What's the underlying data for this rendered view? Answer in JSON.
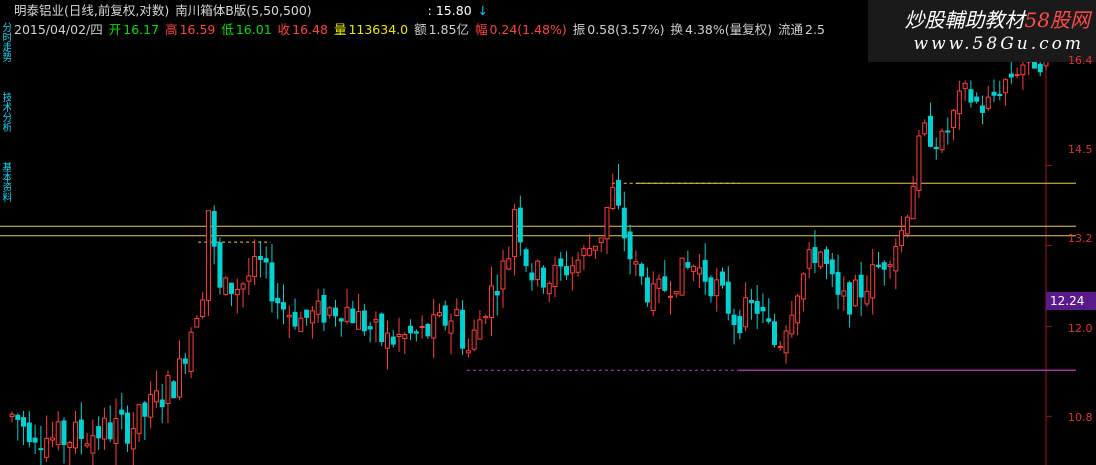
{
  "header": {
    "title": "明泰铝业(日线,前复权,对数)",
    "indicator": "南川箱体B版(5,50,500)",
    "level_value": ": 15.80",
    "date": "2015/04/02/四",
    "open_label": "开",
    "open": "16.17",
    "high_label": "高",
    "high": "16.59",
    "low_label": "低",
    "low": "16.01",
    "close_label": "收",
    "close": "16.48",
    "volume_label": "量",
    "volume": "113634.0",
    "amount_label": "额",
    "amount": "1.85亿",
    "change_label": "幅",
    "change": "0.24(1.48%)",
    "amplitude_label": "振",
    "amplitude": "0.58(3.57%)",
    "turnover_label": "换",
    "turnover": "4.38%(量复权)",
    "float_label": "流通",
    "float": "2.5"
  },
  "side_tabs": [
    "分时走势",
    "技术分析",
    "基本资料"
  ],
  "watermark": {
    "title_prefix": "炒股輔助教材",
    "title_suffix": "58股网",
    "url": "www.58Gu.com"
  },
  "price_box": "12.24",
  "y_ticks": [
    {
      "label": "16.4",
      "value": 16.4
    },
    {
      "label": "14.5",
      "value": 14.5
    },
    {
      "label": "13.2",
      "value": 13.2
    },
    {
      "label": "12.0",
      "value": 12.0
    },
    {
      "label": "10.8",
      "value": 10.8
    }
  ],
  "colors": {
    "up": "#ff3c3c",
    "down": "#00d2d2",
    "box_line": "#e6c84a",
    "support": "#c43cc4",
    "axis": "#a01818"
  },
  "chart_data": {
    "type": "candlestick",
    "levels": [
      {
        "value": 13.35,
        "style": "solid"
      },
      {
        "value": 13.5,
        "style": "solid"
      },
      {
        "value": 14.2,
        "style": "solid"
      },
      {
        "value": 11.4,
        "style": "solid"
      }
    ],
    "segments": [
      {
        "from": 0.18,
        "to": 0.25,
        "value": 13.25,
        "style": "dashed"
      },
      {
        "from": 0.58,
        "to": 0.99,
        "value": 14.2,
        "style": "dashed"
      },
      {
        "from": 0.44,
        "to": 0.99,
        "value": 11.4,
        "style": "dashed"
      }
    ],
    "candles_anchor": [
      [
        0.0,
        10.8
      ],
      [
        0.04,
        10.5
      ],
      [
        0.08,
        10.6
      ],
      [
        0.12,
        10.7
      ],
      [
        0.16,
        11.3
      ],
      [
        0.185,
        12.6
      ],
      [
        0.19,
        13.8
      ],
      [
        0.2,
        12.5
      ],
      [
        0.22,
        12.6
      ],
      [
        0.24,
        12.9
      ],
      [
        0.26,
        12.3
      ],
      [
        0.28,
        12.1
      ],
      [
        0.32,
        12.3
      ],
      [
        0.36,
        11.8
      ],
      [
        0.4,
        11.9
      ],
      [
        0.43,
        12.2
      ],
      [
        0.44,
        11.6
      ],
      [
        0.46,
        12.4
      ],
      [
        0.48,
        13.0
      ],
      [
        0.485,
        13.9
      ],
      [
        0.5,
        12.8
      ],
      [
        0.52,
        12.7
      ],
      [
        0.55,
        13.0
      ],
      [
        0.57,
        13.4
      ],
      [
        0.58,
        14.1
      ],
      [
        0.6,
        12.9
      ],
      [
        0.62,
        12.4
      ],
      [
        0.64,
        12.7
      ],
      [
        0.66,
        12.9
      ],
      [
        0.68,
        12.6
      ],
      [
        0.7,
        12.1
      ],
      [
        0.72,
        12.3
      ],
      [
        0.74,
        11.7
      ],
      [
        0.76,
        12.6
      ],
      [
        0.78,
        13.2
      ],
      [
        0.8,
        12.3
      ],
      [
        0.82,
        12.5
      ],
      [
        0.84,
        12.9
      ],
      [
        0.86,
        13.4
      ],
      [
        0.87,
        14.1
      ],
      [
        0.88,
        15.1
      ],
      [
        0.9,
        14.9
      ],
      [
        0.92,
        15.8
      ],
      [
        0.94,
        15.5
      ],
      [
        0.96,
        16.0
      ],
      [
        0.98,
        16.4
      ]
    ],
    "ylim": [
      10.2,
      16.8
    ]
  }
}
